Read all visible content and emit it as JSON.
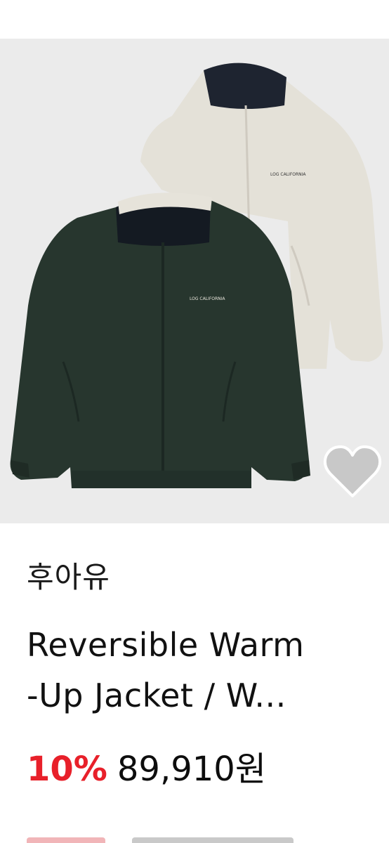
{
  "product": {
    "brand": "후아유",
    "name_line1": "Reversible Warm",
    "name_line2": "-Up Jacket / W...",
    "discount": "10%",
    "price": "89,910원"
  },
  "icons": {
    "wishlist": "heart-icon"
  },
  "colors": {
    "discount": "#e8202a",
    "image_bg": "#ebebeb",
    "heart_fill": "#c8c8c8"
  }
}
